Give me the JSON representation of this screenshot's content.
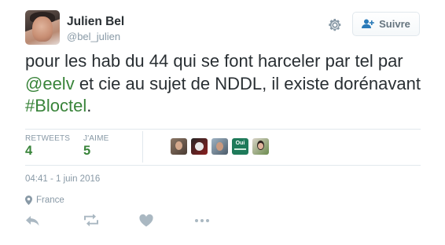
{
  "user": {
    "name": "Julien Bel",
    "handle": "@bel_julien"
  },
  "follow_button": {
    "label": "Suivre"
  },
  "tweet": {
    "text_before_mention": "pour les hab du 44 qui se font harceler par tel par ",
    "mention": "@eelv",
    "text_middle": " et cie au sujet de NDDL, il existe dorénavant ",
    "hashtag": "#Bloctel",
    "text_end": "."
  },
  "stats": {
    "retweets_label": "RETWEETS",
    "retweets_value": "4",
    "likes_label": "J'AIME",
    "likes_value": "5"
  },
  "likers": [
    {
      "avatar": "avatar-1",
      "color": "#7a6a5a"
    },
    {
      "avatar": "avatar-2",
      "color": "#3a3a3a"
    },
    {
      "avatar": "avatar-3",
      "color": "#5b6b7a"
    },
    {
      "avatar": "avatar-4-oui",
      "color": "#1f7a5a",
      "text": "Oui"
    },
    {
      "avatar": "avatar-5",
      "color": "#6a8a4a"
    }
  ],
  "meta": {
    "timestamp": "04:41 - 1 juin 2016",
    "location": "France"
  },
  "icons": {
    "settings": "gear-icon",
    "follow": "add-user-icon",
    "location": "map-pin-icon",
    "reply": "reply-icon",
    "retweet": "retweet-icon",
    "like": "heart-icon",
    "more": "more-icon"
  },
  "colors": {
    "link": "#39843a",
    "muted": "#8899a6",
    "text": "#292f33"
  }
}
